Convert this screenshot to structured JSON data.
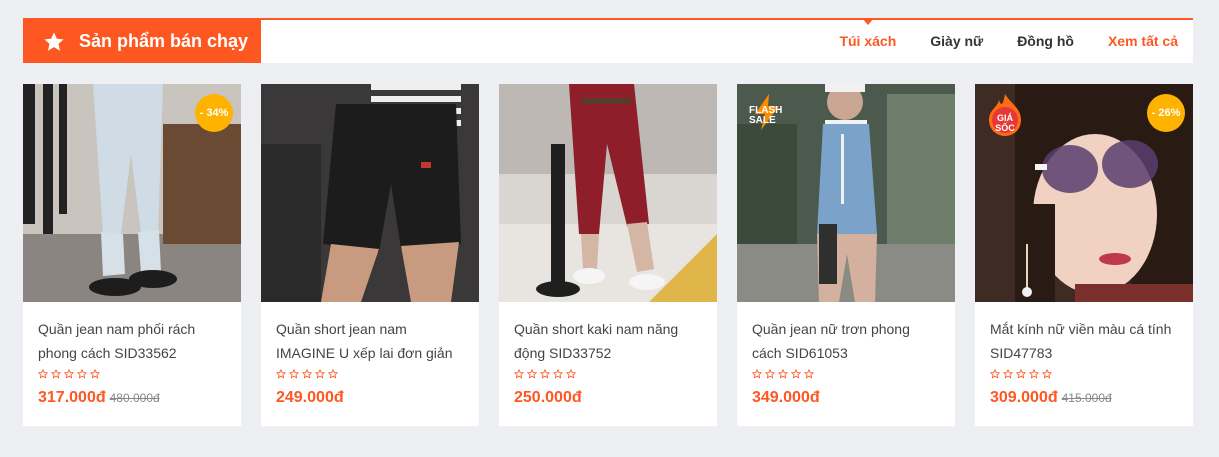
{
  "section": {
    "title": "Sản phẩm bán chạy",
    "icon": "star-icon",
    "accent_color": "#ff5722",
    "tabs": [
      {
        "label": "Túi xách",
        "active": true
      },
      {
        "label": "Giày nữ",
        "active": false
      },
      {
        "label": "Đồng hồ",
        "active": false
      }
    ],
    "view_all": "Xem tất cả"
  },
  "products": [
    {
      "name": "Quần jean nam phối rách phong cách SID33562",
      "price": "317.000đ",
      "old_price": "480.000đ",
      "discount": "- 34%",
      "rating": 0
    },
    {
      "name": "Quần short jean nam IMAGINE U xếp lai đơn giản",
      "price": "249.000đ",
      "old_price": "",
      "discount": "",
      "rating": 0
    },
    {
      "name": "Quần short kaki nam năng động SID33752",
      "price": "250.000đ",
      "old_price": "",
      "discount": "",
      "rating": 0
    },
    {
      "name": "Quần jean nữ trơn phong cách SID61053",
      "price": "349.000đ",
      "old_price": "",
      "discount": "",
      "badge": "FLASH SALE",
      "rating": 0
    },
    {
      "name": "Mắt kính nữ viền màu cá tính SID47783",
      "price": "309.000đ",
      "old_price": "415.000đ",
      "discount": "- 26%",
      "badge": "GIÁ SỐC",
      "rating": 0
    }
  ]
}
